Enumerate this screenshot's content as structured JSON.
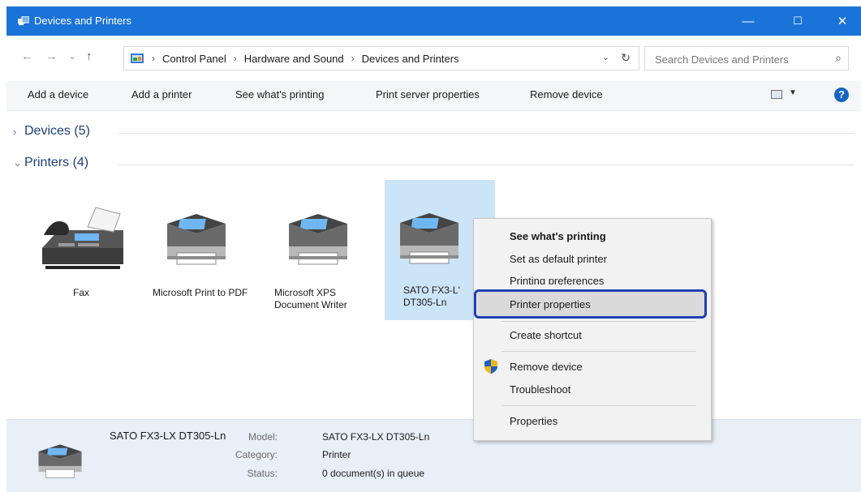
{
  "window": {
    "title": "Devices and Printers",
    "controls": {
      "minimize": "—",
      "maximize": "☐",
      "close": "✕"
    }
  },
  "address_bar": {
    "back": "←",
    "forward": "→",
    "recent": "⌄",
    "up": "↑",
    "breadcrumbs": [
      "Control Panel",
      "Hardware and Sound",
      "Devices and Printers"
    ],
    "separator": "›",
    "dropdown": "⌄",
    "refresh": "↻",
    "search_placeholder": "Search Devices and Printers",
    "search_icon": "⌕"
  },
  "toolbar": {
    "add_device": "Add a device",
    "add_printer": "Add a printer",
    "see_printing": "See what's printing",
    "print_server": "Print server properties",
    "remove_device": "Remove device",
    "view_dropdown": "▼",
    "help": "?"
  },
  "groups": {
    "devices": {
      "label": "Devices (5)",
      "chevron": "›"
    },
    "printers": {
      "label": "Printers (4)",
      "chevron": "⌄"
    }
  },
  "printers": [
    {
      "name": "Fax",
      "icon": "fax-icon"
    },
    {
      "name": "Microsoft Print to PDF",
      "icon": "printer-icon"
    },
    {
      "name": "Microsoft XPS Document Writer",
      "icon": "printer-icon"
    },
    {
      "name": "SATO FX3-L' DT305-Ln",
      "icon": "printer-icon",
      "selected": true
    }
  ],
  "context_menu": {
    "items": [
      {
        "label": "See what's printing",
        "bold": true
      },
      {
        "label": "Set as default printer"
      },
      {
        "label": "Printing preferences"
      },
      {
        "label": "Printer properties",
        "highlighted": true
      },
      {
        "label": "Create shortcut"
      },
      {
        "label": "Remove device",
        "icon": "uac-shield-icon"
      },
      {
        "label": "Troubleshoot"
      },
      {
        "label": "Properties"
      }
    ]
  },
  "details": {
    "name": "SATO FX3-LX DT305-Ln",
    "model_key": "Model:",
    "model": "SATO FX3-LX DT305-Ln",
    "category_key": "Category:",
    "category": "Printer",
    "status_key": "Status:",
    "status": "0 document(s) in queue"
  },
  "colors": {
    "titlebar": "#1a73d8",
    "selection": "#cce4f7",
    "highlight_border": "#1f3fb4",
    "details_bg": "#e9eff7"
  }
}
